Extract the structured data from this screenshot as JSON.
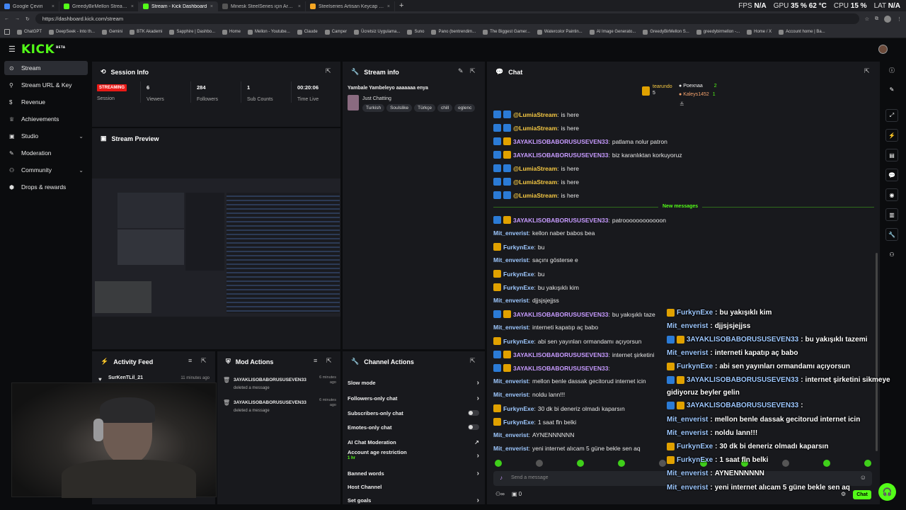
{
  "browser": {
    "tabs": [
      {
        "label": "Google Çeviri",
        "color": "#4285f4",
        "active": false
      },
      {
        "label": "GreedyBirMellon Stream - Watch L",
        "color": "#53fc18",
        "active": false
      },
      {
        "label": "Stream - Kick Dashboard",
        "color": "#53fc18",
        "active": true
      },
      {
        "label": "Minesk SteelSeries için Arctis 1/3...",
        "color": "#555",
        "active": false
      },
      {
        "label": "Steelseries Artisan Keycap Wow Ed...",
        "color": "#f5a623",
        "active": false
      }
    ],
    "new_tab": "+",
    "perf": {
      "fps_label": "FPS",
      "fps": "N/A",
      "gpu_label": "GPU",
      "gpu": "35 %  62 °C",
      "cpu_label": "CPU",
      "cpu": "15 %",
      "lat_label": "LAT",
      "lat": "N/A"
    },
    "url": "https://dashboard.kick.com/stream",
    "bookmarks": [
      "ChatGPT",
      "DeepSeek - Into th...",
      "Gemini",
      "BTK Akademi",
      "Sapphire | Dashbo...",
      "Home",
      "Mellon - Youtube...",
      "Claude",
      "Camper",
      "Ücretsiz Uygulama...",
      "Suno",
      "Pano (bentrendim...",
      "The Biggest Gamer...",
      "Watercolor Paintin...",
      "AI Image Generato...",
      "GreedyBirMellon S...",
      "greedybirmellon -...",
      "Home / X",
      "Account home | Ba..."
    ]
  },
  "kick": {
    "logo": "KICK",
    "logo_sup": "BETA"
  },
  "sidebar": {
    "items": [
      {
        "label": "Stream",
        "active": true,
        "chevron": false
      },
      {
        "label": "Stream URL & Key",
        "active": false,
        "chevron": false
      },
      {
        "label": "Revenue",
        "active": false,
        "chevron": false
      },
      {
        "label": "Achievements",
        "active": false,
        "chevron": false
      },
      {
        "label": "Studio",
        "active": false,
        "chevron": true
      },
      {
        "label": "Moderation",
        "active": false,
        "chevron": false
      },
      {
        "label": "Community",
        "active": false,
        "chevron": true
      },
      {
        "label": "Drops & rewards",
        "active": false,
        "chevron": false
      }
    ]
  },
  "session": {
    "title": "Session Info",
    "badge": "STREAMING",
    "badge_label": "Session",
    "viewers": "6",
    "viewers_label": "Viewers",
    "followers": "284",
    "followers_label": "Followers",
    "subs": "1",
    "subs_label": "Sub Counts",
    "time": "00:20:06",
    "time_label": "Time Live"
  },
  "preview": {
    "title": "Stream Preview"
  },
  "stream_info": {
    "title": "Stream info",
    "stream_title": "Yambale Yambeleyo aaaaaaa enya",
    "category": "Just Chatting",
    "tags": [
      "Turkish",
      "Soulslike",
      "Türkçe",
      "chill",
      "eglenc"
    ]
  },
  "activity": {
    "title": "Activity Feed",
    "user": "SurKenTLil_21",
    "time": "11 minutes ago"
  },
  "mod_actions": {
    "title": "Mod Actions",
    "items": [
      {
        "user": "3AYAKLISOBABORUSUSEVEN33",
        "action": "deleted a message",
        "time": "6 minutes ago"
      },
      {
        "user": "3AYAKLISOBABORUSUSEVEN33",
        "action": "deleted a message",
        "time": "6 minutes ago"
      }
    ]
  },
  "channel_actions": {
    "title": "Channel Actions",
    "items": [
      {
        "label": "Slow mode",
        "control": "chevron"
      },
      {
        "label": "Followers-only chat",
        "control": "chevron"
      },
      {
        "label": "Subscribers-only chat",
        "control": "toggle"
      },
      {
        "label": "Emotes-only chat",
        "control": "toggle"
      },
      {
        "label": "AI Chat Moderation",
        "control": "external"
      },
      {
        "label": "Account age restriction",
        "sub": "1 hr",
        "control": "chevron"
      },
      {
        "label": "Banned words",
        "control": "chevron"
      },
      {
        "label": "Host Channel",
        "control": "none"
      },
      {
        "label": "Set goals",
        "control": "chevron"
      }
    ]
  },
  "chat": {
    "title": "Chat",
    "top_gifters": [
      {
        "name": "tearundo",
        "count": "5"
      },
      {
        "name": "Poexnaa",
        "count": "2"
      },
      {
        "name": "Kaleys1452",
        "count": "1"
      }
    ],
    "new_messages_label": "New messages",
    "messages": [
      {
        "user": "@LumiaStream",
        "text": "is here",
        "color": "#f5c843",
        "badges": [
          "b1",
          "b1"
        ]
      },
      {
        "user": "@LumiaStream",
        "text": "is here",
        "color": "#f5c843",
        "badges": [
          "b1",
          "b1"
        ]
      },
      {
        "user": "3AYAKLISOBABORUSUSEVEN33",
        "text": "patlama nolur patron",
        "color": "#c79bff",
        "badges": [
          "b1",
          "b2"
        ]
      },
      {
        "user": "3AYAKLISOBABORUSUSEVEN33",
        "text": "biz karanlıktan korkuyoruz",
        "color": "#c79bff",
        "badges": [
          "b1",
          "b2"
        ]
      },
      {
        "user": "@LumiaStream",
        "text": "is here",
        "color": "#f5c843",
        "badges": [
          "b1",
          "b1"
        ]
      },
      {
        "user": "@LumiaStream",
        "text": "is here",
        "color": "#f5c843",
        "badges": [
          "b1",
          "b1"
        ]
      },
      {
        "user": "@LumiaStream",
        "text": "is here",
        "color": "#f5c843",
        "badges": [
          "b1",
          "b1"
        ]
      },
      {
        "user": "3AYAKLISOBABORUSUSEVEN33",
        "text": "patroooooooooooon",
        "color": "#c79bff",
        "badges": [
          "b1",
          "b2"
        ]
      },
      {
        "user": "Mit_enverist",
        "text": "kellon naber babos bea",
        "color": "#9ec8ff",
        "badges": []
      },
      {
        "user": "FurkynExe",
        "text": "bu",
        "color": "#9ec8ff",
        "badges": [
          "b2"
        ]
      },
      {
        "user": "Mit_enverist",
        "text": "saçını gösterse e",
        "color": "#9ec8ff",
        "badges": []
      },
      {
        "user": "FurkynExe",
        "text": "bu",
        "color": "#9ec8ff",
        "badges": [
          "b2"
        ]
      },
      {
        "user": "FurkynExe",
        "text": "bu yakışıklı kim",
        "color": "#9ec8ff",
        "badges": [
          "b2"
        ]
      },
      {
        "user": "Mit_enverist",
        "text": "djjsjsjejjss",
        "color": "#9ec8ff",
        "badges": []
      },
      {
        "user": "3AYAKLISOBABORUSUSEVEN33",
        "text": "bu yakışıklı taze",
        "color": "#c79bff",
        "badges": [
          "b1",
          "b2"
        ]
      },
      {
        "user": "Mit_enverist",
        "text": "interneti kapatıp aç babo",
        "color": "#9ec8ff",
        "badges": []
      },
      {
        "user": "FurkynExe",
        "text": "abi sen yayınları ormandamı açıyorsun",
        "color": "#9ec8ff",
        "badges": [
          "b2"
        ]
      },
      {
        "user": "3AYAKLISOBABORUSUSEVEN33",
        "text": "internet şirketini",
        "color": "#c79bff",
        "badges": [
          "b1",
          "b2"
        ]
      },
      {
        "user": "3AYAKLISOBABORUSUSEVEN33",
        "text": "",
        "color": "#c79bff",
        "badges": [
          "b1",
          "b2"
        ]
      },
      {
        "user": "Mit_enverist",
        "text": "mellon benle dassak gecitorud internet icin",
        "color": "#9ec8ff",
        "badges": []
      },
      {
        "user": "Mit_enverist",
        "text": "noldu lann!!!",
        "color": "#9ec8ff",
        "badges": []
      },
      {
        "user": "FurkynExe",
        "text": "30 dk bi deneriz olmadı kaparsın",
        "color": "#9ec8ff",
        "badges": [
          "b2"
        ]
      },
      {
        "user": "FurkynExe",
        "text": "1 saat fln belki",
        "color": "#9ec8ff",
        "badges": [
          "b2"
        ]
      },
      {
        "user": "Mit_enverist",
        "text": "AYNENNNNNN",
        "color": "#9ec8ff",
        "badges": []
      },
      {
        "user": "Mit_enverist",
        "text": "yeni internet alıcam 5 güne bekle sen aq",
        "color": "#9ec8ff",
        "badges": []
      }
    ],
    "input_placeholder": "Send a message",
    "send_label": "Chat",
    "footer_count": "0"
  },
  "overlay": {
    "messages": [
      {
        "user": "FurkynExe",
        "text": "bu yakışıklı kim",
        "badges": [
          "b2"
        ]
      },
      {
        "user": "Mit_enverist",
        "text": "djjsjsjejjss",
        "badges": []
      },
      {
        "user": "3AYAKLISOBABORUSUSEVEN33",
        "text": "bu yakışıklı tazemi",
        "badges": [
          "b1",
          "b2"
        ]
      },
      {
        "user": "Mit_enverist",
        "text": "interneti kapatıp aç babo",
        "badges": []
      },
      {
        "user": "FurkynExe",
        "text": "abi sen yayınları ormandamı açıyorsun",
        "badges": [
          "b2"
        ]
      },
      {
        "user": "3AYAKLISOBABORUSUSEVEN33",
        "text": "internet şirketini sikmeye",
        "badges": [
          "b1",
          "b2"
        ]
      },
      {
        "user": "",
        "text": "gidiyoruz beyler gelin",
        "badges": []
      },
      {
        "user": "3AYAKLISOBABORUSUSEVEN33",
        "text": "",
        "badges": [
          "b1",
          "b2"
        ]
      },
      {
        "user": "Mit_enverist",
        "text": "mellon benle dassak gecitorud internet icin",
        "badges": []
      },
      {
        "user": "Mit_enverist",
        "text": "noldu lann!!!",
        "badges": []
      },
      {
        "user": "FurkynExe",
        "text": "30 dk bi deneriz olmadı kaparsın",
        "badges": [
          "b2"
        ]
      },
      {
        "user": "FurkynExe",
        "text": "1 saat fln belki",
        "badges": [
          "b2"
        ]
      },
      {
        "user": "Mit_enverist",
        "text": "AYNENNNNNN",
        "badges": []
      },
      {
        "user": "Mit_enverist",
        "text": "yeni internet alıcam 5 güne bekle sen aq",
        "badges": []
      }
    ]
  },
  "colors": {
    "accent": "#53fc18",
    "live": "#e91916",
    "panel": "#18191d",
    "bg": "#0b0c0e"
  }
}
